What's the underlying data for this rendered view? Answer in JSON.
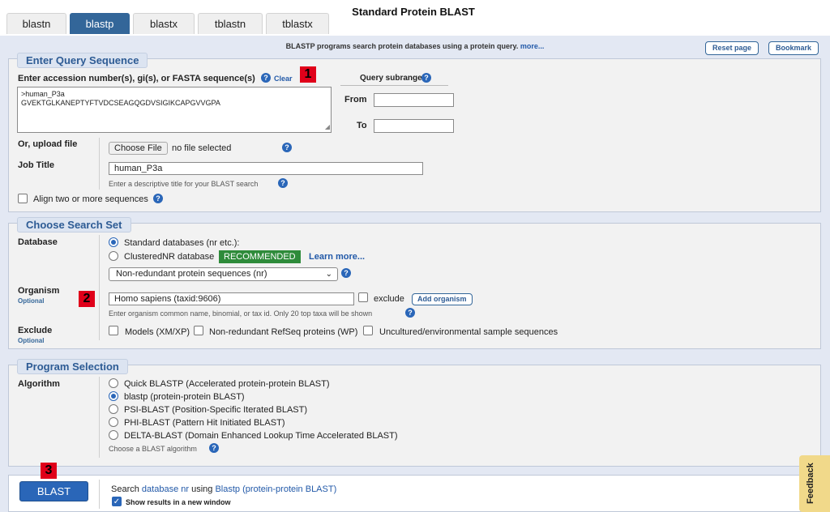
{
  "app_title": "Standard Protein BLAST",
  "tabs": [
    "blastn",
    "blastp",
    "blastx",
    "tblastn",
    "tblastx"
  ],
  "active_tab": "blastp",
  "info": {
    "text": "BLASTP programs search protein databases using a protein query.",
    "more": "more..."
  },
  "buttons": {
    "reset": "Reset page",
    "bookmark": "Bookmark"
  },
  "query": {
    "legend": "Enter Query Sequence",
    "label": "Enter accession number(s), gi(s), or FASTA sequence(s)",
    "clear": "Clear",
    "line1": ">human_P3a",
    "line2": "GVEKTGLKANEPTYFTVDCSEAGQGDVSIGIKCAPGVVGPA",
    "subrange_label": "Query subrange",
    "from_label": "From",
    "to_label": "To",
    "upload_label": "Or, upload file",
    "choose_file": "Choose File",
    "no_file": "no file selected",
    "job_title_label": "Job Title",
    "job_title_value": "human_P3a",
    "job_title_hint": "Enter a descriptive title for your BLAST search",
    "align_label": "Align two or more sequences"
  },
  "search_set": {
    "legend": "Choose Search Set",
    "database_label": "Database",
    "db_option1": "Standard databases (nr etc.):",
    "db_option2": "ClusteredNR database",
    "recommended": "RECOMMENDED",
    "learn_more": "Learn more...",
    "db_select": "Non-redundant protein sequences (nr)",
    "organism_label": "Organism",
    "optional": "Optional",
    "organism_value": "Homo sapiens (taxid:9606)",
    "exclude_checkbox": "exclude",
    "add_organism": "Add organism",
    "organism_hint": "Enter organism common name, binomial, or tax id. Only 20 top taxa will be shown",
    "exclude_label": "Exclude",
    "exclude_models": "Models (XM/XP)",
    "exclude_refseq": "Non-redundant RefSeq proteins (WP)",
    "exclude_uncultured": "Uncultured/environmental sample sequences"
  },
  "program": {
    "legend": "Program Selection",
    "algorithm_label": "Algorithm",
    "options": [
      "Quick BLASTP (Accelerated protein-protein BLAST)",
      "blastp (protein-protein BLAST)",
      "PSI-BLAST (Position-Specific Iterated BLAST)",
      "PHI-BLAST (Pattern Hit Initiated BLAST)",
      "DELTA-BLAST (Domain Enhanced Lookup Time Accelerated BLAST)"
    ],
    "selected_index": 1,
    "hint": "Choose a BLAST algorithm"
  },
  "submit": {
    "blast_button": "BLAST",
    "search_prefix": "Search",
    "database_link": "database nr",
    "using": "using",
    "program_link": "Blastp (protein-protein BLAST)",
    "new_window": "Show results in a new window"
  },
  "feedback": "Feedback",
  "markers": [
    "1",
    "2",
    "3"
  ],
  "colors": {
    "accent": "#336699",
    "recommended": "#2e8b3a",
    "marker": "#e0001a",
    "feedback": "#f1d98a"
  }
}
